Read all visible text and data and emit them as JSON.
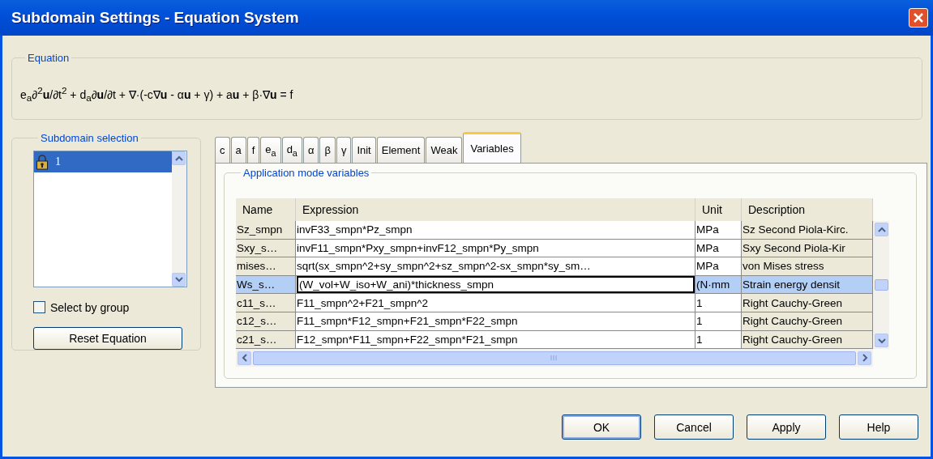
{
  "window": {
    "title": "Subdomain Settings - Equation System"
  },
  "equation": {
    "label": "Equation",
    "text": "e$_{a}$∂$^{2}$**u**/∂t$^{2}$ + d$_{a}$∂**u**/∂t + ∇·(-c∇**u** - α**u** + γ) + a**u** + β·∇**u** = f"
  },
  "subdomain_selection": {
    "label": "Subdomain selection",
    "items": [
      {
        "label": "1",
        "selected": true
      }
    ],
    "select_by_group": {
      "label": "Select by group",
      "checked": false
    },
    "reset_button": "Reset Equation"
  },
  "tabs": [
    {
      "label": "c",
      "selected": false
    },
    {
      "label": "a",
      "selected": false
    },
    {
      "label": "f",
      "selected": false
    },
    {
      "label": "e$_{a}$",
      "selected": false
    },
    {
      "label": "d$_{a}$",
      "selected": false
    },
    {
      "label": "α",
      "selected": false
    },
    {
      "label": "β",
      "selected": false
    },
    {
      "label": "γ",
      "selected": false
    },
    {
      "label": "Init",
      "selected": false
    },
    {
      "label": "Element",
      "selected": false
    },
    {
      "label": "Weak",
      "selected": false
    },
    {
      "label": "Variables",
      "selected": true
    }
  ],
  "variables": {
    "label": "Application mode variables",
    "columns": [
      "Name",
      "Expression",
      "Unit",
      "Description"
    ],
    "rows": [
      {
        "name": "Sz_smpn",
        "expression": "invF33_smpn*Pz_smpn",
        "unit": "MPa",
        "description": "Sz Second Piola-Kirc.",
        "selected": false,
        "editing": false
      },
      {
        "name": "Sxy_s…",
        "expression": "invF11_smpn*Pxy_smpn+invF12_smpn*Py_smpn",
        "unit": "MPa",
        "description": "Sxy Second Piola-Kir",
        "selected": false,
        "editing": false
      },
      {
        "name": "mises…",
        "expression": "sqrt(sx_smpn^2+sy_smpn^2+sz_smpn^2-sx_smpn*sy_sm…",
        "unit": "MPa",
        "description": "von Mises stress",
        "selected": false,
        "editing": false
      },
      {
        "name": "Ws_s…",
        "expression": "(W_vol+W_iso+W_ani)*thickness_smpn",
        "unit": "(N·mm",
        "description": "Strain energy densit",
        "selected": true,
        "editing": true
      },
      {
        "name": "c11_s…",
        "expression": "F11_smpn^2+F21_smpn^2",
        "unit": "1",
        "description": "Right Cauchy-Green",
        "selected": false,
        "editing": false
      },
      {
        "name": "c12_s…",
        "expression": "F11_smpn*F12_smpn+F21_smpn*F22_smpn",
        "unit": "1",
        "description": "Right Cauchy-Green",
        "selected": false,
        "editing": false
      },
      {
        "name": "c21_s…",
        "expression": "F12_smpn*F11_smpn+F22_smpn*F21_smpn",
        "unit": "1",
        "description": "Right Cauchy-Green",
        "selected": false,
        "editing": false
      }
    ]
  },
  "buttons": [
    {
      "label": "OK",
      "default": true
    },
    {
      "label": "Cancel",
      "default": false
    },
    {
      "label": "Apply",
      "default": false
    },
    {
      "label": "Help",
      "default": false
    }
  ]
}
